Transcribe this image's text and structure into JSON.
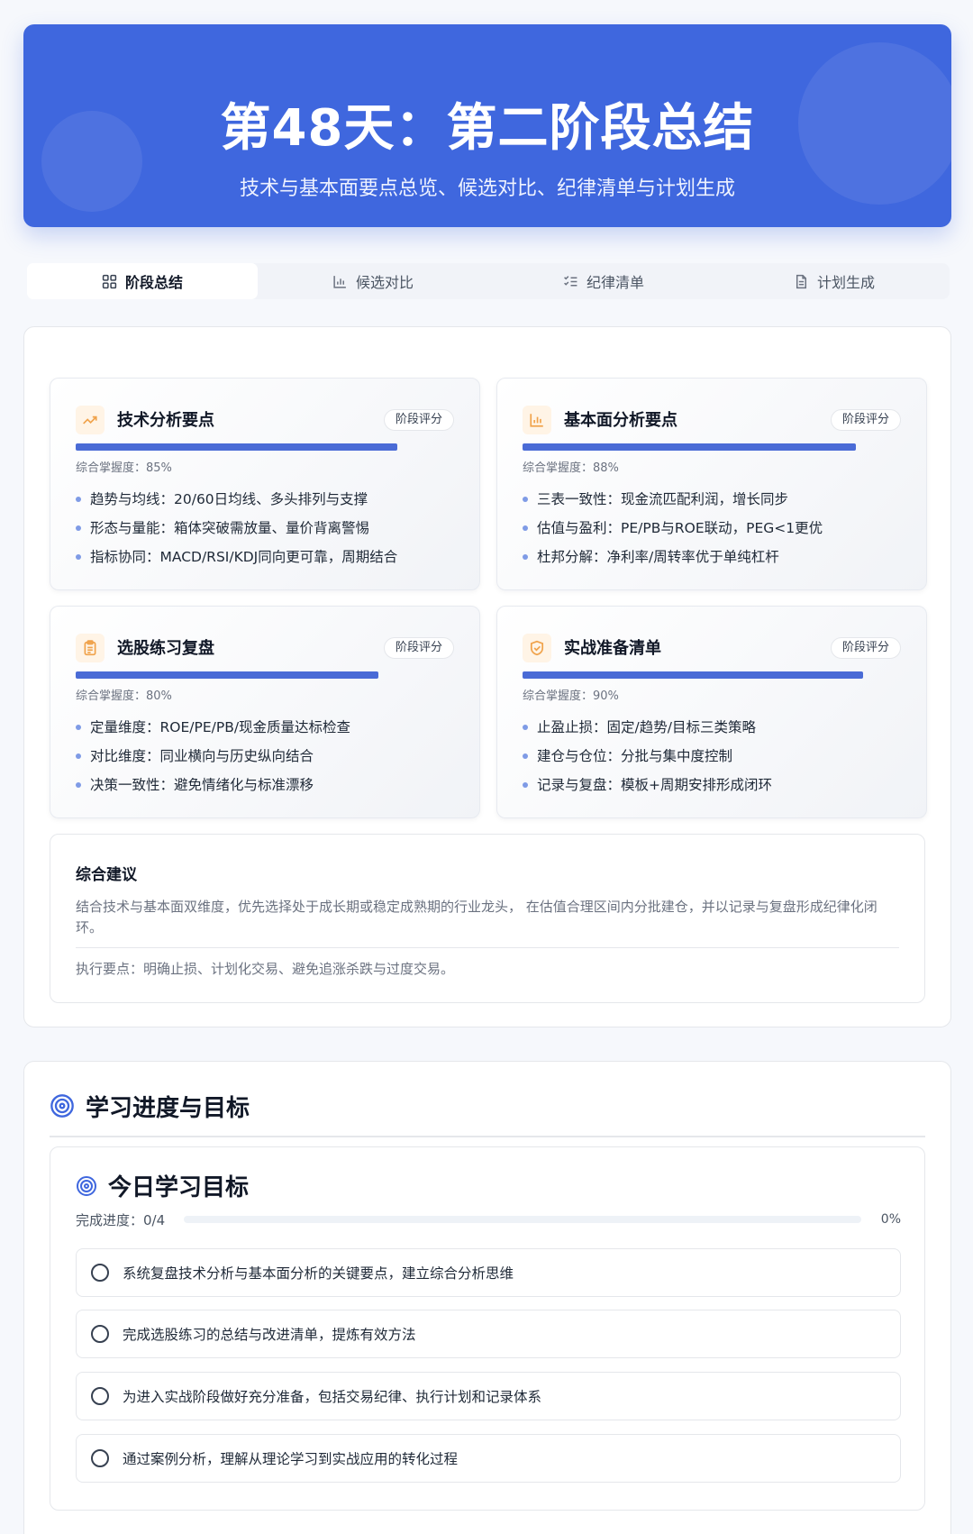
{
  "hero": {
    "title": "第48天：第二阶段总结",
    "subtitle": "技术与基本面要点总览、候选对比、纪律清单与计划生成"
  },
  "tabs": [
    {
      "label": "阶段总结",
      "icon": "grid-icon",
      "active": true
    },
    {
      "label": "候选对比",
      "icon": "bar-chart-icon",
      "active": false
    },
    {
      "label": "纪律清单",
      "icon": "checklist-icon",
      "active": false
    },
    {
      "label": "计划生成",
      "icon": "document-icon",
      "active": false
    }
  ],
  "cards": [
    {
      "title": "技术分析要点",
      "icon": "trending-up-icon",
      "badge": "阶段评分",
      "mastery_label": "综合掌握度：85%",
      "mastery": 0.85,
      "points": [
        "趋势与均线：20/60日均线、多头排列与支撑",
        "形态与量能：箱体突破需放量、量价背离警惕",
        "指标协同：MACD/RSI/KDJ同向更可靠，周期结合"
      ]
    },
    {
      "title": "基本面分析要点",
      "icon": "bar-chart-icon",
      "badge": "阶段评分",
      "mastery_label": "综合掌握度：88%",
      "mastery": 0.88,
      "points": [
        "三表一致性：现金流匹配利润，增长同步",
        "估值与盈利：PE/PB与ROE联动，PEG<1更优",
        "杜邦分解：净利率/周转率优于单纯杠杆"
      ]
    },
    {
      "title": "选股练习复盘",
      "icon": "clipboard-icon",
      "badge": "阶段评分",
      "mastery_label": "综合掌握度：80%",
      "mastery": 0.8,
      "points": [
        "定量维度：ROE/PE/PB/现金质量达标检查",
        "对比维度：同业横向与历史纵向结合",
        "决策一致性：避免情绪化与标准漂移"
      ]
    },
    {
      "title": "实战准备清单",
      "icon": "shield-check-icon",
      "badge": "阶段评分",
      "mastery_label": "综合掌握度：90%",
      "mastery": 0.9,
      "points": [
        "止盈止损：固定/趋势/目标三类策略",
        "建仓与仓位：分批与集中度控制",
        "记录与复盘：模板+周期安排形成闭环"
      ]
    }
  ],
  "advice": {
    "title": "综合建议",
    "body": "结合技术与基本面双维度，优先选择处于成长期或稳定成熟期的行业龙头， 在估值合理区间内分批建仓，并以记录与复盘形成纪律化闭环。",
    "exec": "执行要点：明确止损、计划化交易、避免追涨杀跌与过度交易。"
  },
  "progress_section": {
    "title": "学习进度与目标",
    "icon": "target-icon",
    "goals_title": "今日学习目标",
    "progress_label": "完成进度：0/4",
    "progress_pct": "0%",
    "progress": 0,
    "goals": [
      "系统复盘技术分析与基本面分析的关键要点，建立综合分析思维",
      "完成选股练习的总结与改进清单，提炼有效方法",
      "为进入实战阶段做好充分准备，包括交易纪律、执行计划和记录体系",
      "通过案例分析，理解从理论学习到实战应用的转化过程"
    ]
  },
  "colors": {
    "hero": "#3f67de",
    "accent": "#4a6bd6",
    "icon_bg": "#fff4e6",
    "icon_fg": "#f0a24a"
  }
}
